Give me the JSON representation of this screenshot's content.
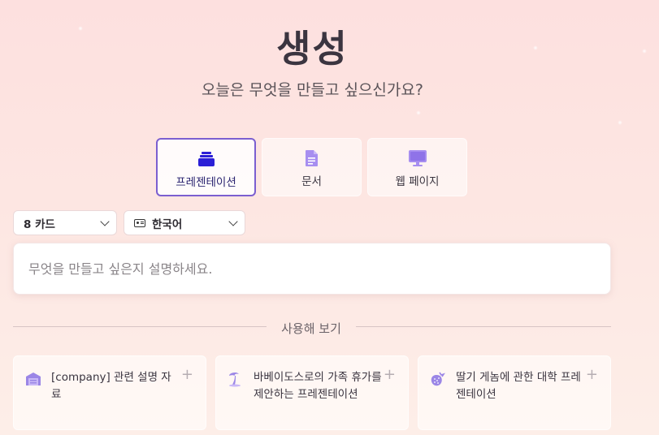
{
  "header": {
    "title": "생성",
    "subtitle": "오늘은 무엇을 만들고 싶으신가요?"
  },
  "type_tabs": [
    {
      "label": "프레젠테이션",
      "icon": "presentation-stack-icon",
      "active": true
    },
    {
      "label": "문서",
      "icon": "document-icon",
      "active": false
    },
    {
      "label": "웹 페이지",
      "icon": "monitor-icon",
      "active": false
    }
  ],
  "options": {
    "card_count": "8 카드",
    "language": "한국어"
  },
  "prompt": {
    "placeholder": "무엇을 만들고 싶은지 설명하세요."
  },
  "examples": {
    "divider_label": "사용해 보기",
    "cards": [
      {
        "text": "[company] 관련 설명 자료",
        "icon": "building-icon"
      },
      {
        "text": "바베이도스로의 가족 휴가를 제안하는 프레젠테이션",
        "icon": "palm-tree-icon"
      },
      {
        "text": "딸기 게놈에 관한 대학 프레젠테이션",
        "icon": "strawberry-icon"
      }
    ]
  },
  "colors": {
    "accent": "#7b5fd0",
    "icon_dark": "#2b1fd6",
    "icon_light": "#a78ef0"
  }
}
